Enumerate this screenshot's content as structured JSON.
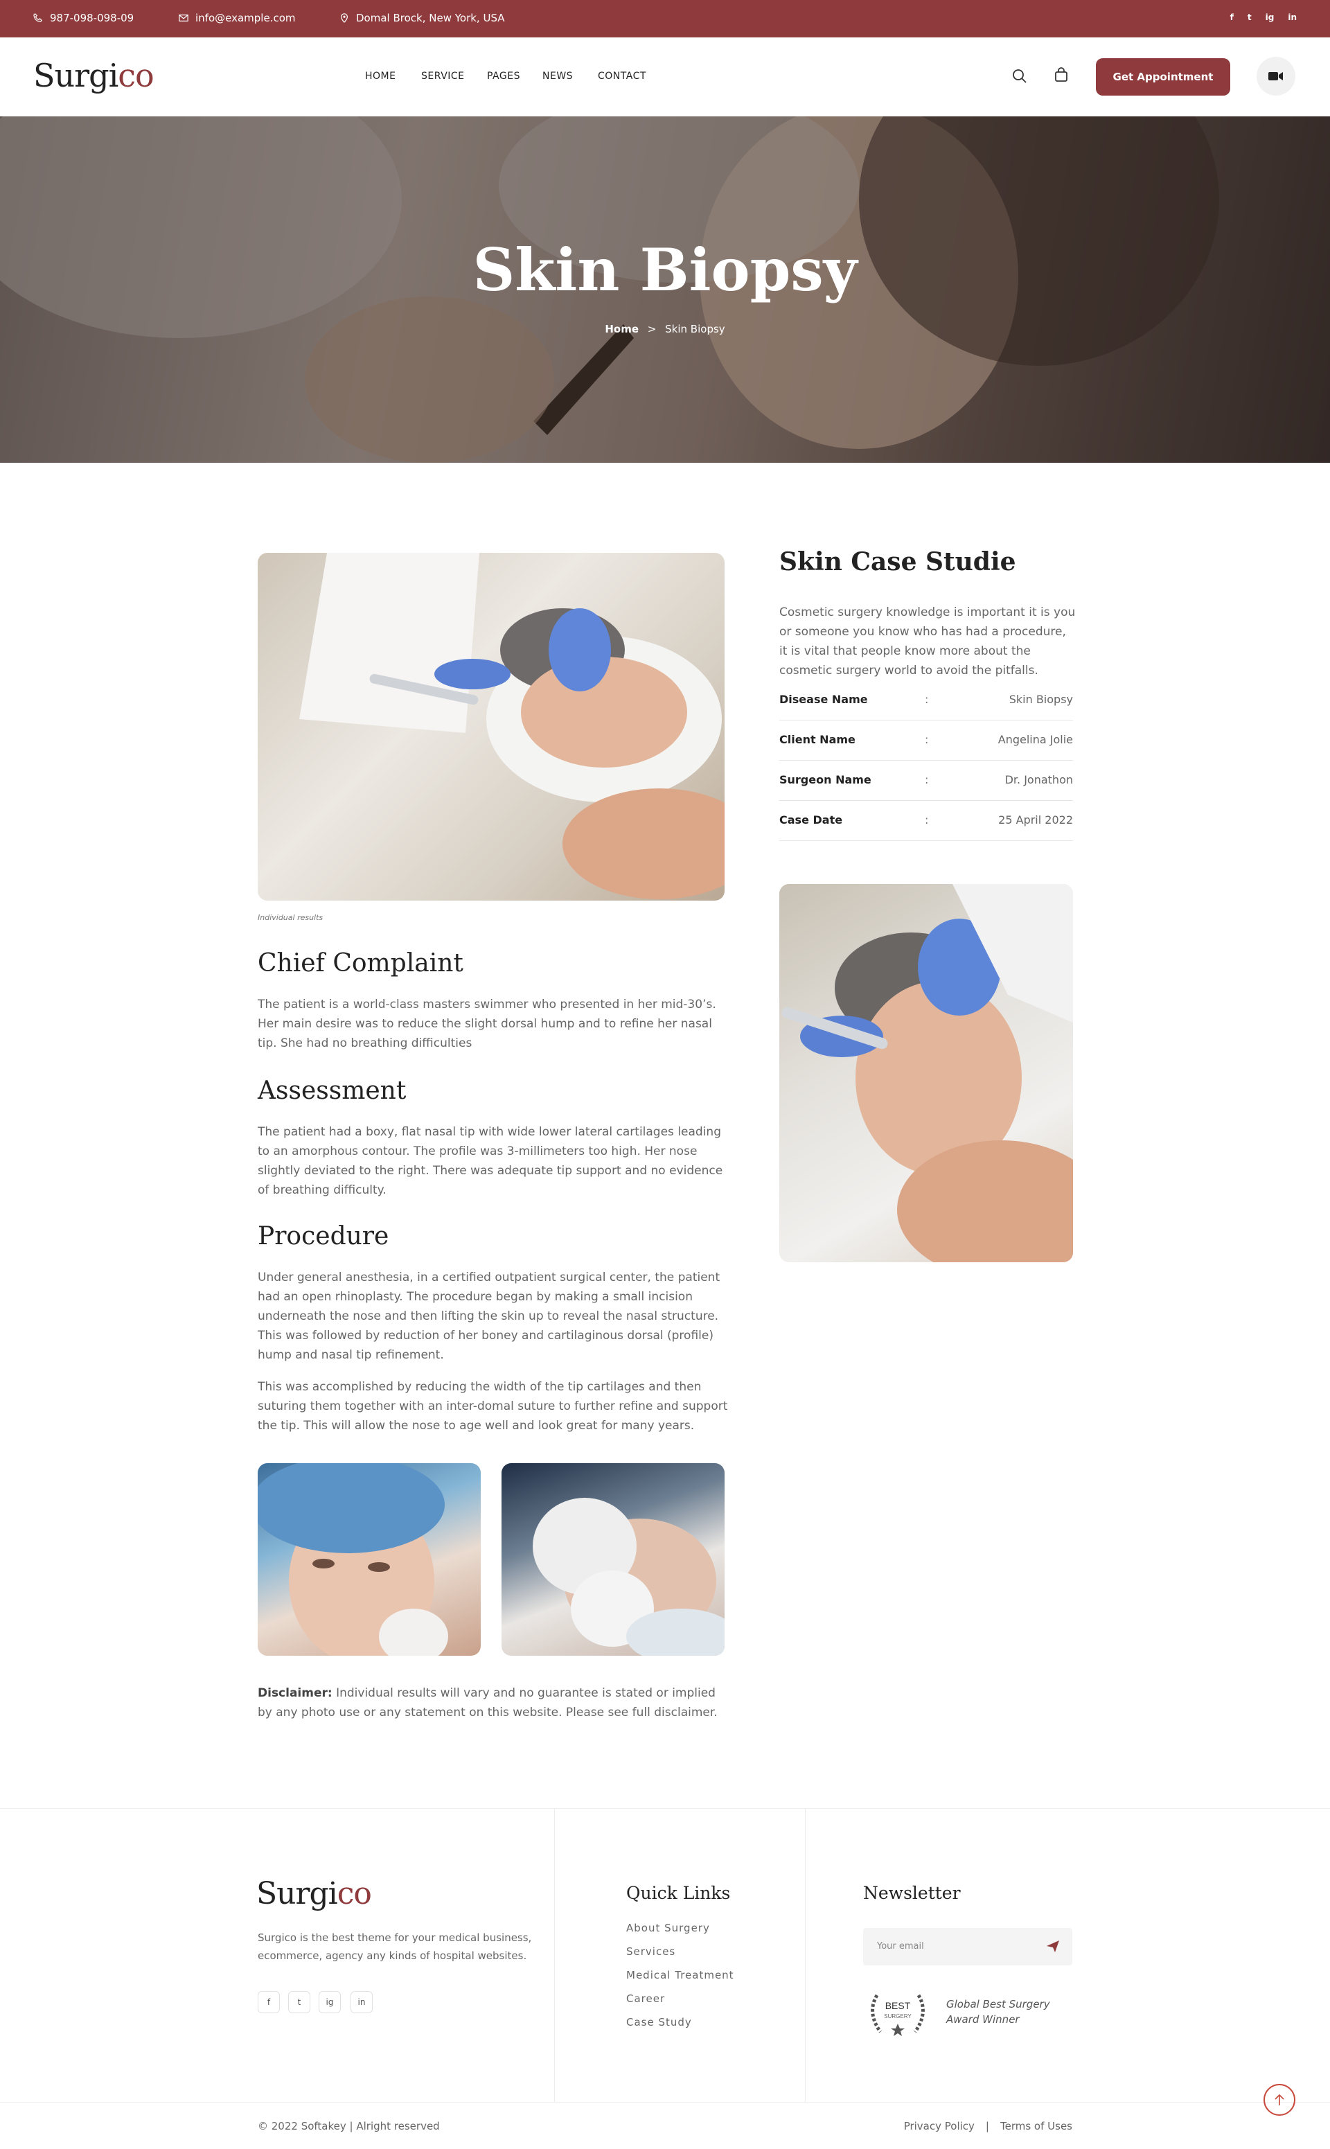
{
  "topbar": {
    "phone": "987-098-098-09",
    "email": "info@example.com",
    "address": "Domal Brock, New York, USA",
    "social": [
      "f",
      "t",
      "ig",
      "in"
    ]
  },
  "header": {
    "logo_main": "Surgi",
    "logo_accent": "co",
    "nav": [
      "HOME",
      "SERVICE",
      "PAGES",
      "NEWS",
      "CONTACT"
    ],
    "cta": "Get Appointment"
  },
  "hero": {
    "title": "Skin Biopsy",
    "crumb_home": "Home",
    "crumb_sep": ">",
    "crumb_current": "Skin Biopsy"
  },
  "main": {
    "caption": "Individual results",
    "sections": [
      {
        "title": "Chief Complaint",
        "paras": [
          "The patient is a world-class masters swimmer who presented in her mid-30’s. Her main desire was to reduce the slight dorsal hump and to refine her nasal tip. She had no breathing difficulties"
        ]
      },
      {
        "title": "Assessment",
        "paras": [
          "The patient had a boxy, flat nasal tip with wide lower lateral cartilages leading to an amorphous contour. The profile was 3-millimeters too high. Her nose slightly deviated to the right. There was adequate tip support and no evidence of breathing difficulty."
        ]
      },
      {
        "title": "Procedure",
        "paras": [
          "Under general anesthesia, in a certified outpatient surgical center, the patient had an open rhinoplasty. The procedure began by making a small incision underneath the nose and then lifting the skin up to reveal the nasal structure. This was followed by reduction of her boney and cartilaginous dorsal (profile) hump and nasal tip refinement.",
          "This was accomplished by reducing the width of the tip cartilages and then suturing them together with an inter-domal suture to further refine and support the tip. This will allow the nose to age well and look great for many years."
        ]
      }
    ],
    "disclaimer_label": "Disclaimer:",
    "disclaimer_text": " Individual results will vary and no guarantee is stated or implied by any photo use or any statement on this website. Please see full disclaimer."
  },
  "sidebar": {
    "title": "Skin Case Studie",
    "text": "Cosmetic surgery knowledge is important it is you or someone you know who has had a procedure, it is vital that people know more about the cosmetic surgery world to avoid the pitfalls.",
    "rows": [
      {
        "k": "Disease Name",
        "c": ":",
        "v": "Skin Biopsy"
      },
      {
        "k": "Client Name",
        "c": ":",
        "v": "Angelina Jolie"
      },
      {
        "k": "Surgeon Name",
        "c": ":",
        "v": "Dr. Jonathon"
      },
      {
        "k": "Case Date",
        "c": ":",
        "v": "25 April 2022"
      }
    ]
  },
  "footer": {
    "logo_main": "Surgi",
    "logo_accent": "co",
    "desc": "Surgico is the best theme for your medical business, ecommerce, agency any kinds of hospital websites.",
    "social": [
      "f",
      "t",
      "ig",
      "in"
    ],
    "quick_title": "Quick Links",
    "links": [
      "About Surgery",
      "Services",
      "Medical Treatment",
      "Career",
      "Case Study"
    ],
    "news_title": "Newsletter",
    "email_placeholder": "Your email",
    "badge_top": "BEST",
    "badge_bottom": "SURGERY",
    "award_line1": "Global Best Surgery",
    "award_line2": "Award Winner",
    "copyright": "© 2022 Softakey | Alright reserved",
    "privacy": "Privacy Policy",
    "sep": "|",
    "terms": "Terms of Uses"
  },
  "colors": {
    "brand": "#8f3a3c",
    "accent_red": "#c94a3c"
  }
}
